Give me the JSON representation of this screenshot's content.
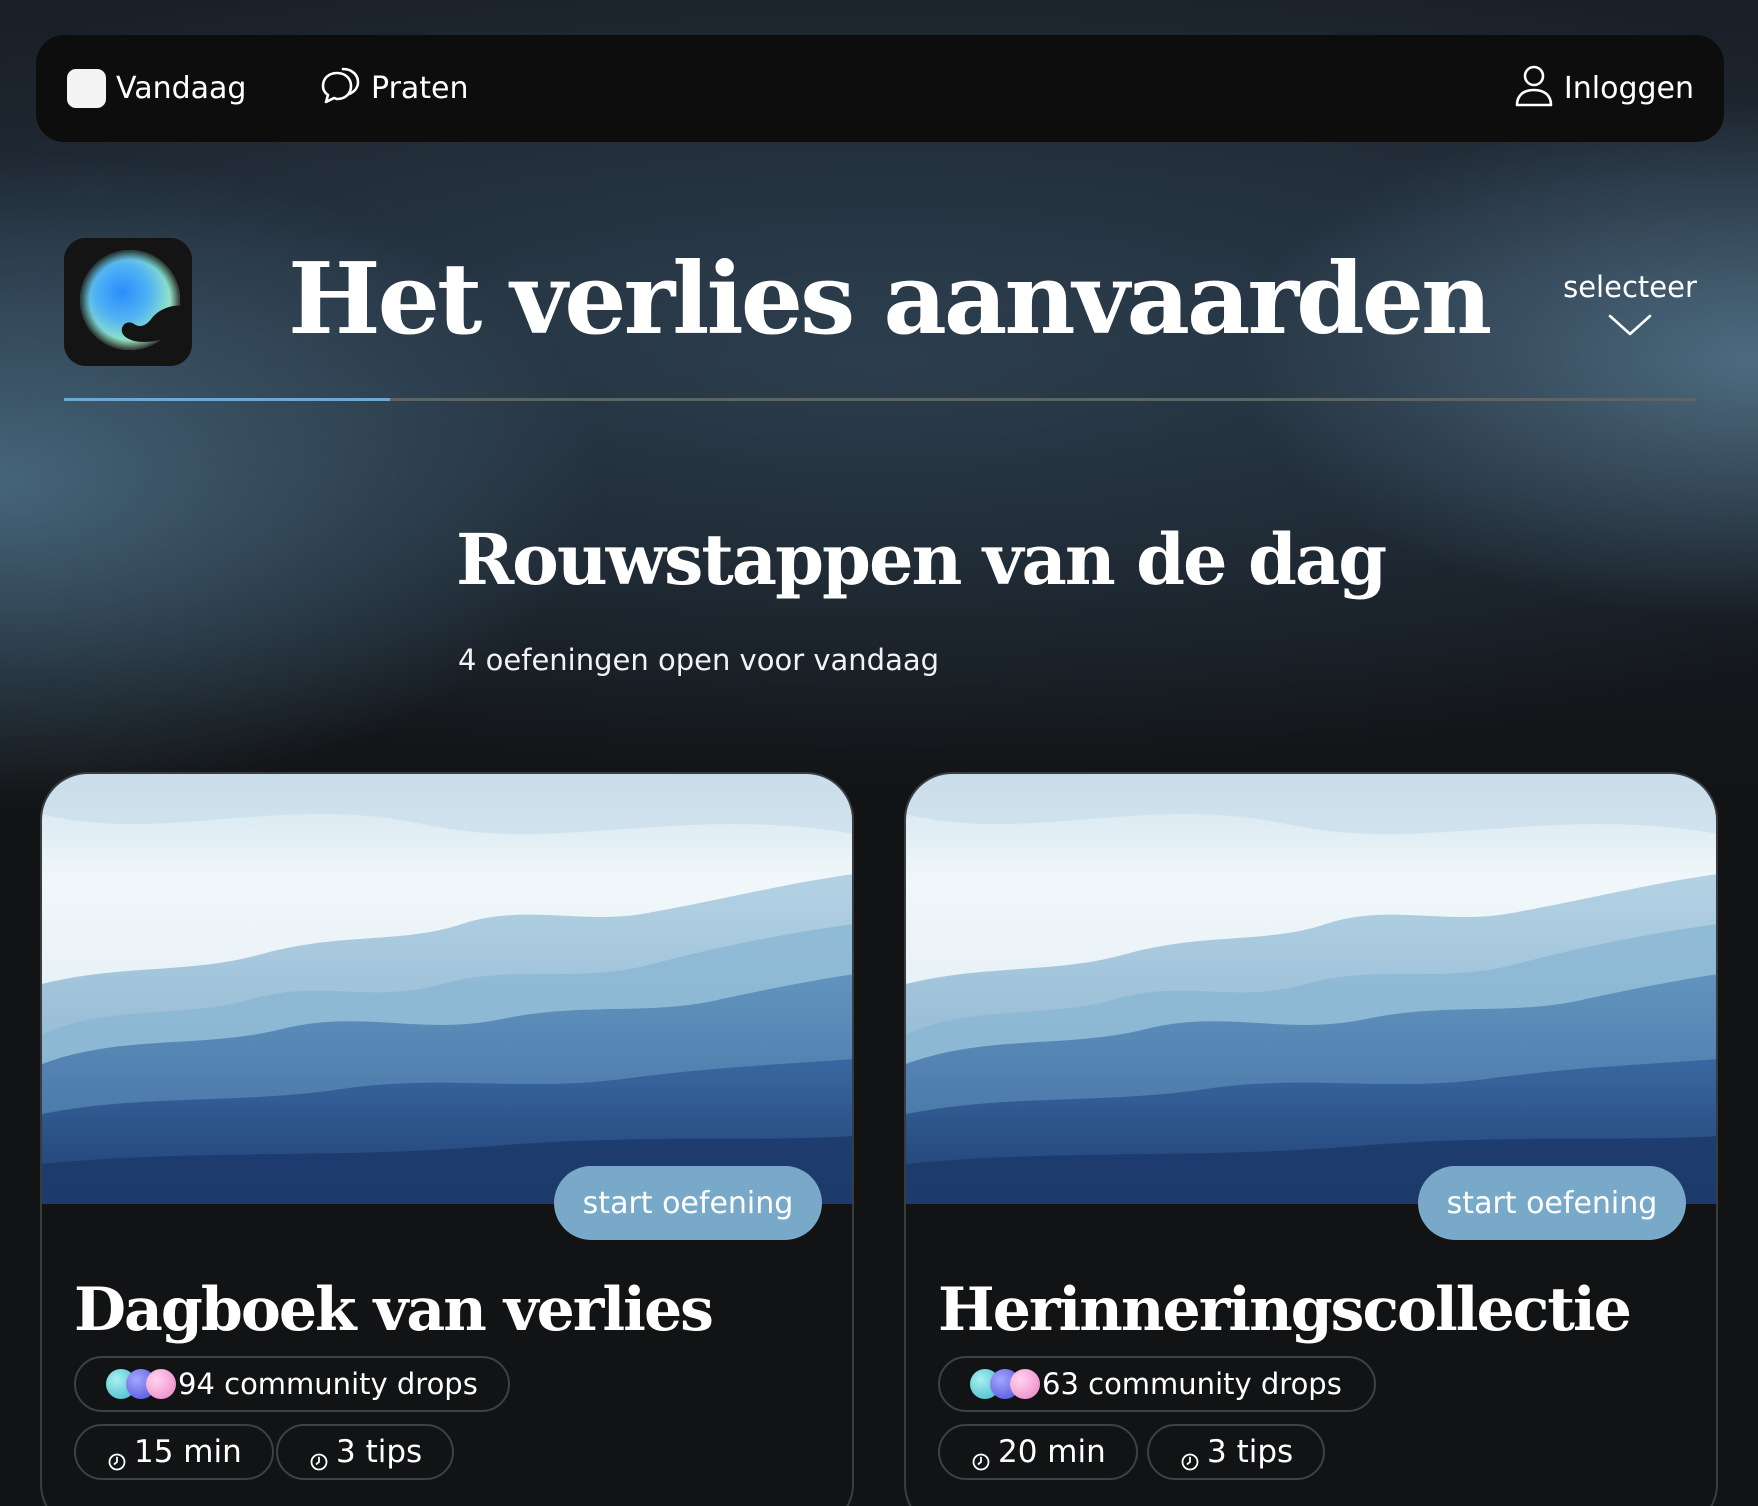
{
  "nav": {
    "today_label": "Vandaag",
    "talk_label": "Praten",
    "login_label": "Inloggen",
    "icons": [
      "square-icon",
      "chat-bubbles-icon",
      "user-icon"
    ]
  },
  "header": {
    "title": "Het verlies aanvaarden",
    "select_label": "selecteer",
    "progress_fraction": 0.2,
    "logo_icon": "app-logo"
  },
  "section": {
    "title": "Rouwstappen van de dag",
    "subtitle": "4 oefeningen open voor vandaag"
  },
  "cards": [
    {
      "title": "Dagboek van verlies",
      "button_label": "start oefening",
      "community": "94 community drops",
      "duration": "15 min",
      "tips": "3 tips",
      "image_icon": "watercolor-waves-image"
    },
    {
      "title": "Herinneringscollectie",
      "button_label": "start oefening",
      "community": "63 community drops",
      "duration": "20 min",
      "tips": "3 tips",
      "image_icon": "watercolor-waves-image"
    }
  ],
  "colors": {
    "accent": "#79a9c8",
    "progress_fill": "#6fa8d0",
    "navbar_bg": "#0d0d0e",
    "page_bg": "#121314"
  }
}
